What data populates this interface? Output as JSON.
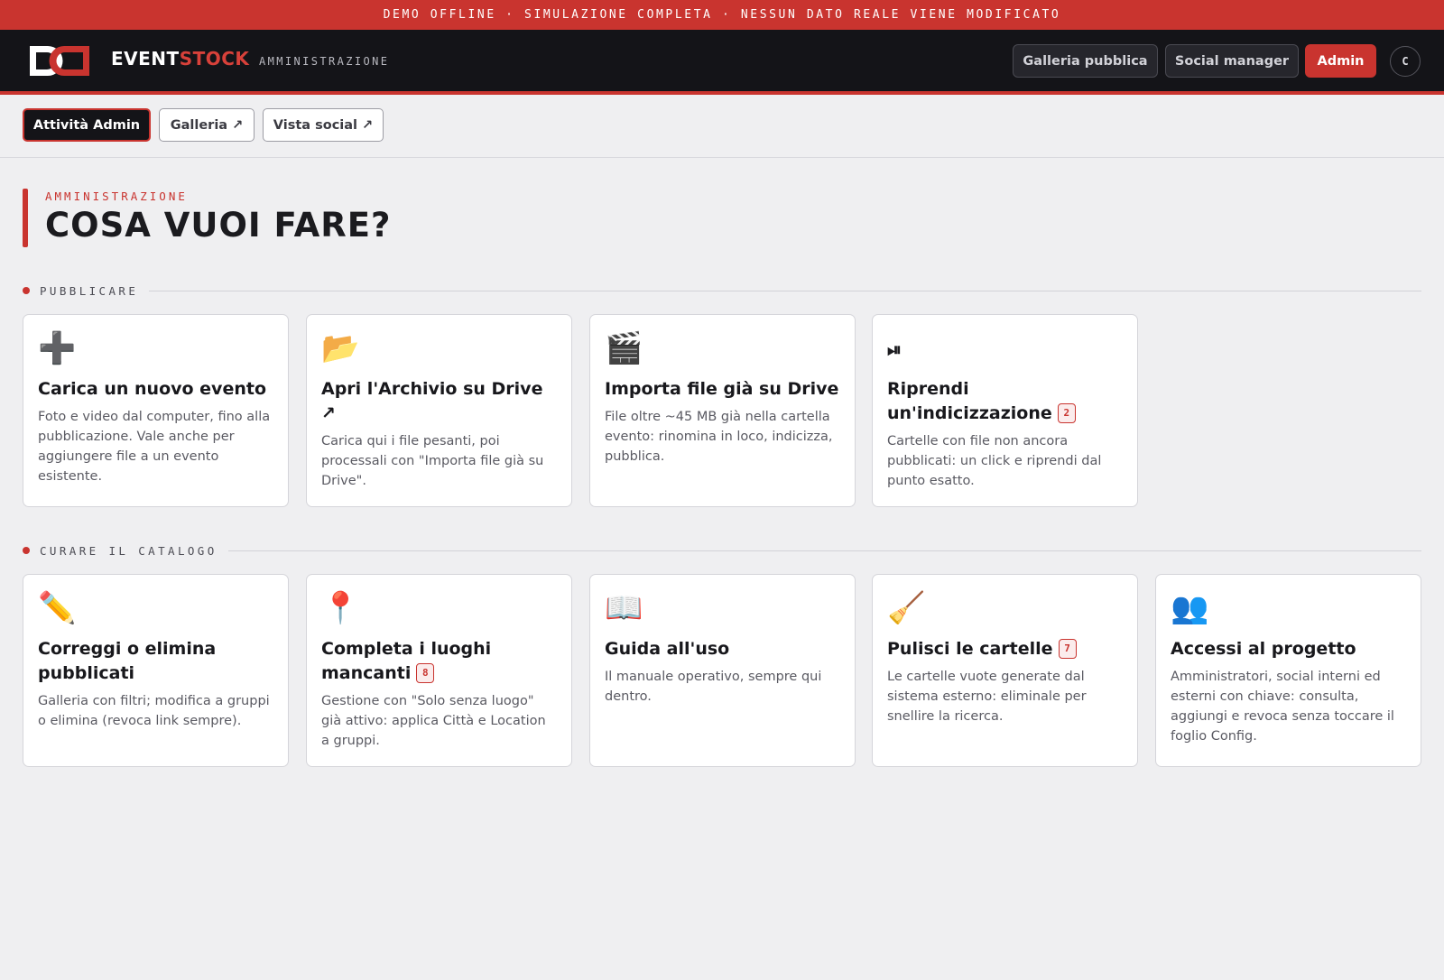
{
  "banner": {
    "text": "DEMO OFFLINE · SIMULAZIONE COMPLETA · NESSUN DATO REALE VIENE MODIFICATO"
  },
  "header": {
    "brand_main": "EVENT",
    "brand_accent": "STOCK",
    "brand_sub": "AMMINISTRAZIONE",
    "buttons": {
      "public_gallery": "Galleria pubblica",
      "social_manager": "Social manager",
      "admin": "Admin"
    },
    "avatar_initial": "C"
  },
  "subnav": {
    "admin_activity": "Attività Admin",
    "gallery": "Galleria ↗",
    "social_view": "Vista social ↗"
  },
  "page": {
    "eyebrow": "AMMINISTRAZIONE",
    "title": "COSA VUOI FARE?"
  },
  "sections": {
    "publish": {
      "label": "PUBBLICARE",
      "cards": [
        {
          "icon": "➕",
          "icon_name": "plus-icon",
          "title": "Carica un nuovo evento",
          "desc": "Foto e video dal computer, fino alla pubblicazione. Vale anche per aggiungere file a un evento esistente."
        },
        {
          "icon": "📂",
          "icon_name": "open-folder-icon",
          "title": "Apri l'Archivio su Drive ↗",
          "desc": "Carica qui i file pesanti, poi processali con \"Importa file già su Drive\"."
        },
        {
          "icon": "🎬",
          "icon_name": "clapperboard-icon",
          "title": "Importa file già su Drive",
          "desc": "File oltre ~45 MB già nella cartella evento: rinomina in loco, indicizza, pubblica."
        },
        {
          "icon": "⏯",
          "icon_name": "play-pause-icon",
          "title": "Riprendi un'indicizzazione",
          "badge": "2",
          "desc": "Cartelle con file non ancora pubblicati: un click e riprendi dal punto esatto."
        }
      ]
    },
    "catalog": {
      "label": "CURARE IL CATALOGO",
      "cards": [
        {
          "icon": "✏️",
          "icon_name": "pencil-icon",
          "title": "Correggi o elimina pubblicati",
          "desc": "Galleria con filtri; modifica a gruppi o elimina (revoca link sempre)."
        },
        {
          "icon": "📍",
          "icon_name": "location-pin-icon",
          "title": "Completa i luoghi mancanti",
          "badge": "8",
          "desc": "Gestione con \"Solo senza luogo\" già attivo: applica Città e Location a gruppi."
        },
        {
          "icon": "📖",
          "icon_name": "open-book-icon",
          "title": "Guida all'uso",
          "desc": "Il manuale operativo, sempre qui dentro."
        },
        {
          "icon": "🧹",
          "icon_name": "broom-icon",
          "title": "Pulisci le cartelle",
          "badge": "7",
          "desc": "Le cartelle vuote generate dal sistema esterno: eliminale per snellire la ricerca."
        },
        {
          "icon": "👥",
          "icon_name": "users-icon",
          "title": "Accessi al progetto",
          "desc": "Amministratori, social interni ed esterni con chiave: consulta, aggiungi e revoca senza toccare il foglio Config."
        }
      ]
    }
  },
  "colors": {
    "accent": "#c9342f",
    "header_bg": "#141418",
    "page_bg": "#efeff1"
  }
}
